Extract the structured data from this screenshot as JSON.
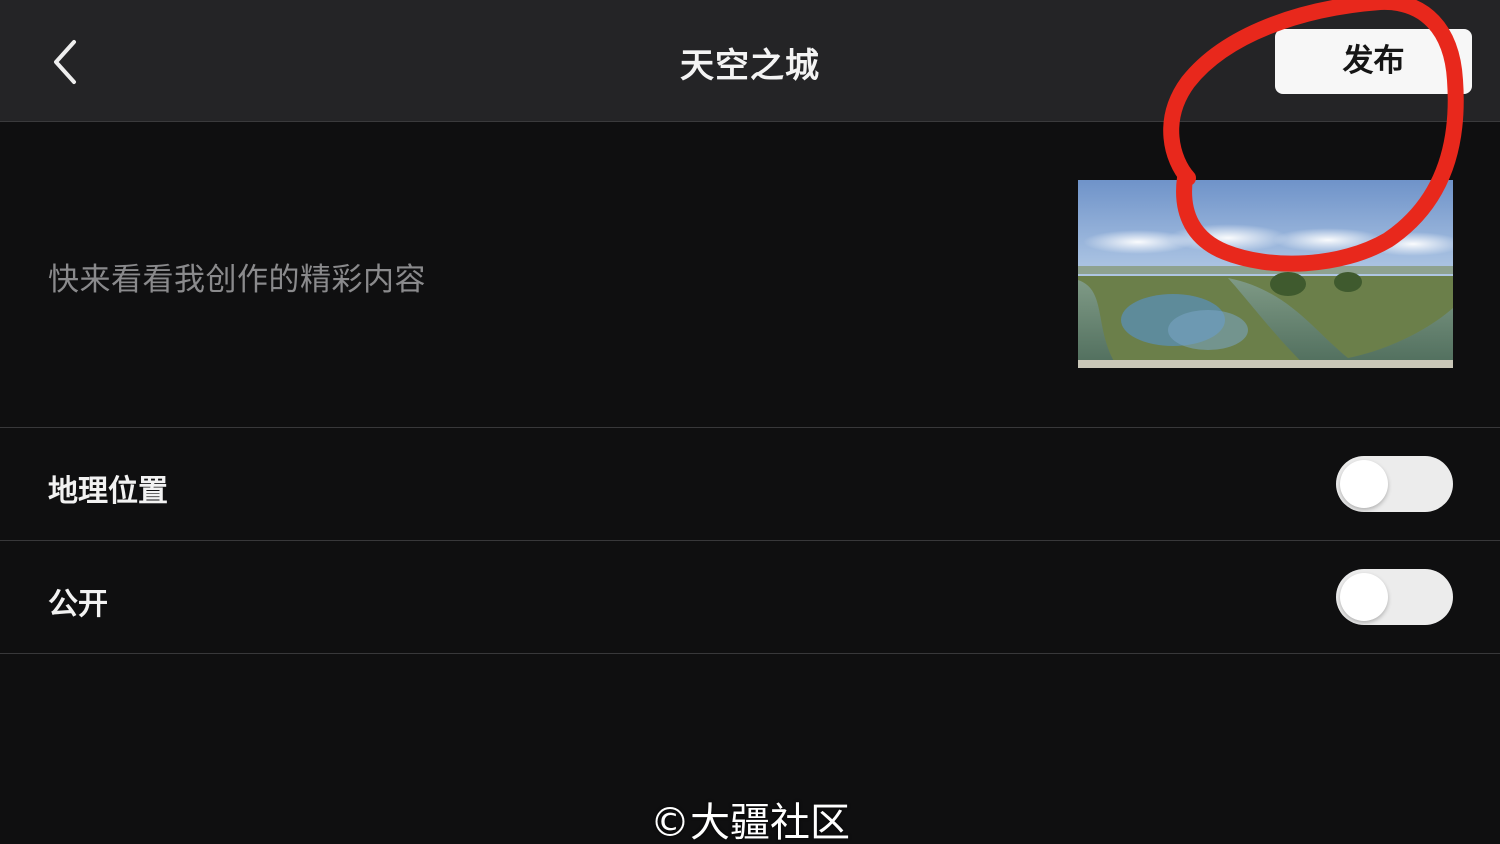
{
  "header": {
    "title": "天空之城",
    "publish_label": "发布"
  },
  "post": {
    "caption": "快来看看我创作的精彩内容"
  },
  "settings": {
    "items": [
      {
        "label": "地理位置",
        "enabled": false
      },
      {
        "label": "公开",
        "enabled": false
      }
    ]
  },
  "watermark": "©大疆社区",
  "colors": {
    "background": "#0f0f10",
    "topbar": "#242426",
    "annotation": "#e8281c"
  }
}
